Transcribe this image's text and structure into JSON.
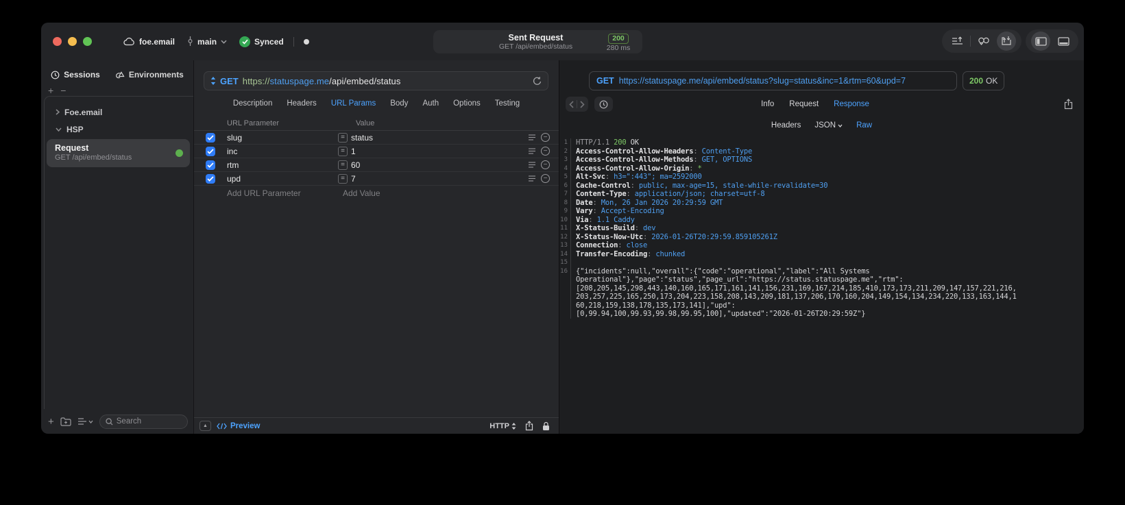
{
  "titlebar": {
    "project": "foe.email",
    "branch": "main",
    "sync_status": "Synced",
    "request_title": "Sent Request",
    "request_subtitle": "GET /api/embed/status",
    "status_code": "200",
    "duration": "280 ms"
  },
  "colors": {
    "accent_blue": "#4da3ff",
    "syntax_blue": "#4f9ff0",
    "green": "#7ec966",
    "checkbox_blue": "#2f7cf6"
  },
  "sidebar": {
    "tabs": [
      {
        "label": "Sessions",
        "icon": "clock-icon"
      },
      {
        "label": "Environments",
        "icon": "environments-icon"
      }
    ],
    "tree": [
      {
        "label": "Foe.email"
      },
      {
        "label": "HSP"
      }
    ],
    "selected_request": {
      "title": "Request",
      "subtitle": "GET /api/embed/status"
    },
    "search_placeholder": "Search"
  },
  "request_pane": {
    "method": "GET",
    "url_scheme": "https://",
    "url_host": "statuspage.me",
    "url_path": "/api/embed/status",
    "tabs": [
      "Description",
      "Headers",
      "URL Params",
      "Body",
      "Auth",
      "Options",
      "Testing"
    ],
    "active_tab": "URL Params",
    "table": {
      "columns": [
        "URL Parameter",
        "Value"
      ],
      "rows": [
        {
          "name": "slug",
          "value": "status",
          "checked": true
        },
        {
          "name": "inc",
          "value": "1",
          "checked": true
        },
        {
          "name": "rtm",
          "value": "60",
          "checked": true
        },
        {
          "name": "upd",
          "value": "7",
          "checked": true
        }
      ],
      "add_name_placeholder": "Add URL Parameter",
      "add_value_placeholder": "Add Value"
    },
    "footer": {
      "preview_label": "Preview",
      "protocol": "HTTP"
    }
  },
  "response_pane": {
    "method": "GET",
    "url": "https://statuspage.me/api/embed/status?slug=status&inc=1&rtm=60&upd=7",
    "status_code": "200",
    "status_text": "OK",
    "tabs": [
      "Info",
      "Request",
      "Response"
    ],
    "active_tab": "Response",
    "subtabs": [
      "Headers",
      "JSON",
      "Raw"
    ],
    "active_subtab": "Raw",
    "lines": [
      {
        "n": "1",
        "s": [
          [
            "HTTP/1.1 ",
            "gray"
          ],
          [
            "200",
            "green"
          ],
          [
            " OK",
            "plain"
          ]
        ]
      },
      {
        "n": "2",
        "s": [
          [
            "Access-Control-Allow-Headers",
            "key"
          ],
          [
            ": ",
            "punct"
          ],
          [
            "Content-Type",
            "val"
          ]
        ]
      },
      {
        "n": "3",
        "s": [
          [
            "Access-Control-Allow-Methods",
            "key"
          ],
          [
            ": ",
            "punct"
          ],
          [
            "GET, OPTIONS",
            "val"
          ]
        ]
      },
      {
        "n": "4",
        "s": [
          [
            "Access-Control-Allow-Origin",
            "key"
          ],
          [
            ": ",
            "punct"
          ],
          [
            "*",
            "green"
          ]
        ]
      },
      {
        "n": "5",
        "s": [
          [
            "Alt-Svc",
            "key"
          ],
          [
            ": ",
            "punct"
          ],
          [
            "h3=\":443\"; ma=2592000",
            "val"
          ]
        ]
      },
      {
        "n": "6",
        "s": [
          [
            "Cache-Control",
            "key"
          ],
          [
            ": ",
            "punct"
          ],
          [
            "public, max-age=15, stale-while-revalidate=30",
            "val"
          ]
        ]
      },
      {
        "n": "7",
        "s": [
          [
            "Content-Type",
            "key"
          ],
          [
            ": ",
            "punct"
          ],
          [
            "application/json; charset=utf-8",
            "val"
          ]
        ]
      },
      {
        "n": "8",
        "s": [
          [
            "Date",
            "key"
          ],
          [
            ": ",
            "punct"
          ],
          [
            "Mon, 26 Jan 2026 20:29:59 GMT",
            "val"
          ]
        ]
      },
      {
        "n": "9",
        "s": [
          [
            "Vary",
            "key"
          ],
          [
            ": ",
            "punct"
          ],
          [
            "Accept-Encoding",
            "val"
          ]
        ]
      },
      {
        "n": "10",
        "s": [
          [
            "Via",
            "key"
          ],
          [
            ": ",
            "punct"
          ],
          [
            "1.1 Caddy",
            "val"
          ]
        ]
      },
      {
        "n": "11",
        "s": [
          [
            "X-Status-Build",
            "key"
          ],
          [
            ": ",
            "punct"
          ],
          [
            "dev",
            "val"
          ]
        ]
      },
      {
        "n": "12",
        "s": [
          [
            "X-Status-Now-Utc",
            "key"
          ],
          [
            ": ",
            "punct"
          ],
          [
            "2026-01-26T20:29:59.859105261Z",
            "val"
          ]
        ]
      },
      {
        "n": "13",
        "s": [
          [
            "Connection",
            "key"
          ],
          [
            ": ",
            "punct"
          ],
          [
            "close",
            "val"
          ]
        ]
      },
      {
        "n": "14",
        "s": [
          [
            "Transfer-Encoding",
            "key"
          ],
          [
            ": ",
            "punct"
          ],
          [
            "chunked",
            "val"
          ]
        ]
      },
      {
        "n": "15",
        "s": []
      },
      {
        "n": "16",
        "s": [
          [
            "{\"incidents\":null,\"overall\":{\"code\":\"operational\",\"label\":\"All Systems",
            "plain"
          ]
        ]
      },
      {
        "n": "",
        "s": [
          [
            "Operational\"},\"page\":\"status\",\"page_url\":\"https://status.statuspage.me\",\"rtm\":",
            "plain"
          ]
        ]
      },
      {
        "n": "",
        "s": [
          [
            "[208,205,145,298,443,140,160,165,171,161,141,156,231,169,167,214,185,410,173,173,211,209,147,157,221,216,",
            "plain"
          ]
        ]
      },
      {
        "n": "",
        "s": [
          [
            "203,257,225,165,250,173,204,223,158,208,143,209,181,137,206,170,160,204,149,154,134,234,220,133,163,144,1",
            "plain"
          ]
        ]
      },
      {
        "n": "",
        "s": [
          [
            "60,218,159,138,178,135,173,141],\"upd\":",
            "plain"
          ]
        ]
      },
      {
        "n": "",
        "s": [
          [
            "[0,99.94,100,99.93,99.98,99.95,100],\"updated\":\"2026-01-26T20:29:59Z\"}",
            "plain"
          ]
        ]
      }
    ]
  }
}
